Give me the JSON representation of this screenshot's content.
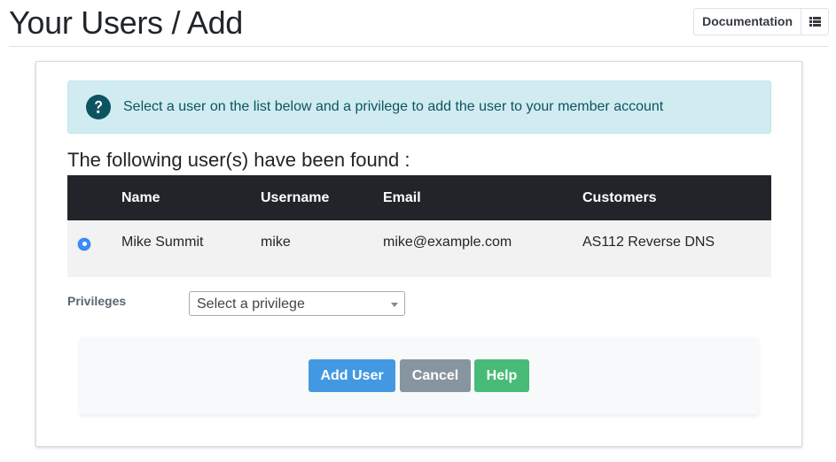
{
  "header": {
    "title": "Your Users / Add",
    "documentation_label": "Documentation",
    "list_icon": "list-icon"
  },
  "alert": {
    "icon": "question-circle-icon",
    "text": "Select a user on the list below and a privilege to add the user to your member account",
    "colors": {
      "background": "#d1ecf1",
      "text": "#0c5460"
    }
  },
  "found_heading": "The following user(s) have been found :",
  "table": {
    "columns": [
      "Name",
      "Username",
      "Email",
      "Customers"
    ],
    "rows": [
      {
        "selected": true,
        "name": "Mike Summit",
        "username": "mike",
        "email": "mike@example.com",
        "customers": "AS112 Reverse DNS"
      }
    ]
  },
  "privileges": {
    "label": "Privileges",
    "placeholder": "Select a privilege"
  },
  "actions": {
    "add_label": "Add User",
    "cancel_label": "Cancel",
    "help_label": "Help",
    "colors": {
      "add": "#4299e1",
      "cancel": "#8795a1",
      "help": "#48bb78"
    }
  }
}
